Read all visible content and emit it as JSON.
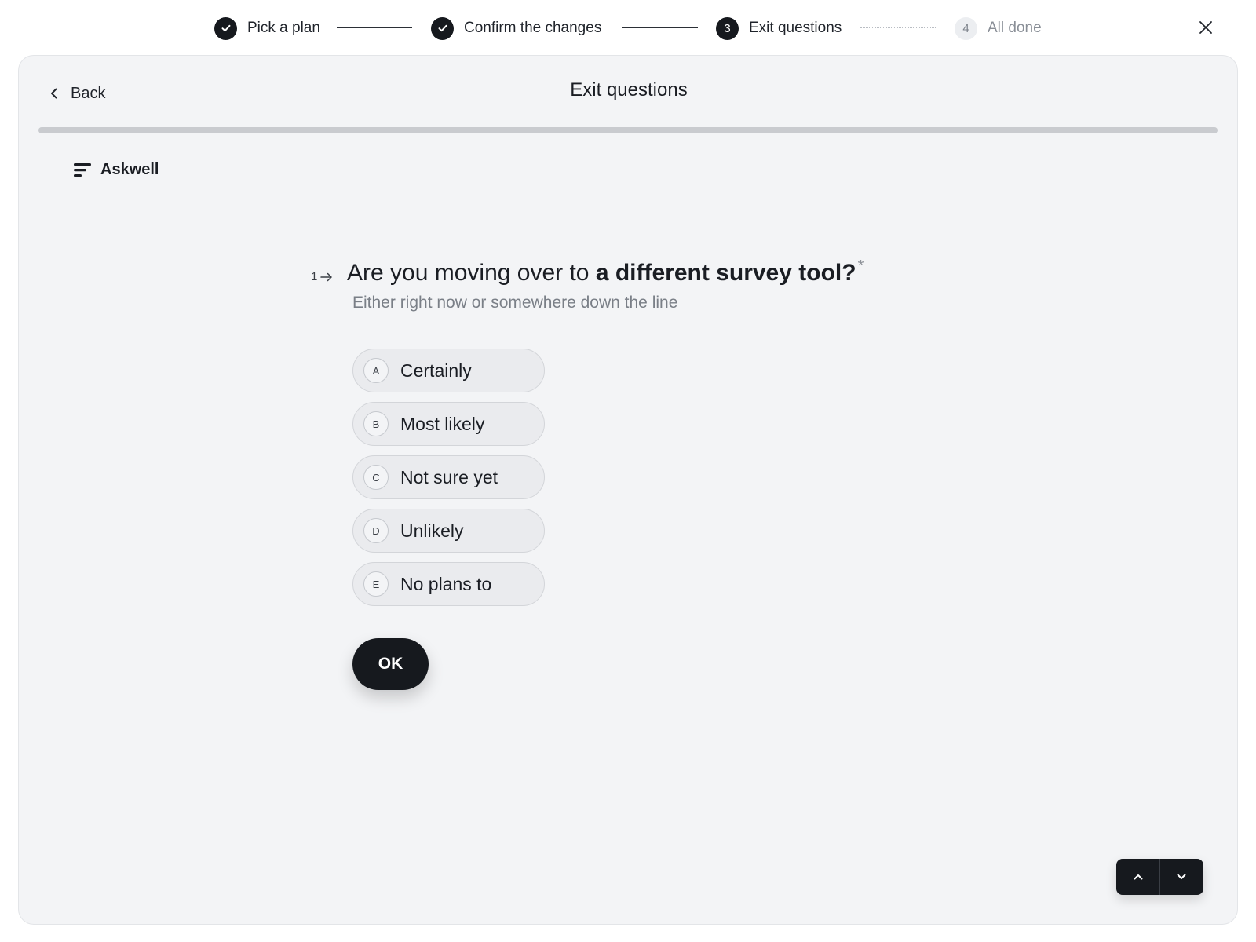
{
  "stepper": {
    "steps": [
      {
        "label": "Pick a plan",
        "marker": "",
        "state": "done"
      },
      {
        "label": "Confirm the changes",
        "marker": "",
        "state": "done"
      },
      {
        "label": "Exit questions",
        "marker": "3",
        "state": "current"
      },
      {
        "label": "All done",
        "marker": "4",
        "state": "upcoming"
      }
    ]
  },
  "header": {
    "back_label": "Back",
    "title": "Exit questions",
    "progress_fraction": 0
  },
  "brand": {
    "name": "Askwell",
    "icon": "menu-lines-icon"
  },
  "question": {
    "number": "1",
    "text_plain": "Are you moving over to ",
    "text_bold": "a different survey tool?",
    "required_mark": "*",
    "subtitle": "Either right now or somewhere down the line",
    "options": [
      {
        "key": "A",
        "label": "Certainly"
      },
      {
        "key": "B",
        "label": "Most likely"
      },
      {
        "key": "C",
        "label": "Not sure yet"
      },
      {
        "key": "D",
        "label": "Unlikely"
      },
      {
        "key": "E",
        "label": "No plans to"
      }
    ],
    "ok_label": "OK"
  },
  "colors": {
    "accent": "#16191e",
    "card_background": "#f3f4f6",
    "option_background": "#eaebee"
  }
}
